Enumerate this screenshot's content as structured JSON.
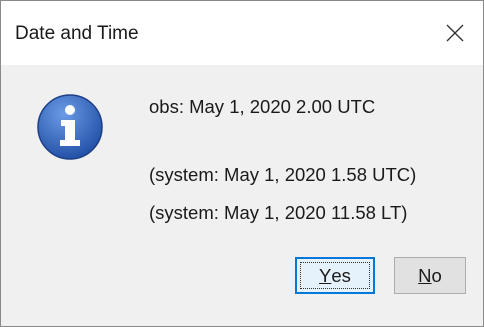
{
  "window": {
    "title": "Date and Time",
    "close_icon": "close-icon"
  },
  "message": {
    "icon": "info-icon",
    "obs": "obs: May 1, 2020 2.00 UTC",
    "system_utc": "(system: May 1, 2020 1.58 UTC)",
    "system_lt": "(system: May 1, 2020 11.58 LT)"
  },
  "buttons": {
    "yes_mnemonic": "Y",
    "yes_rest": "es",
    "no_mnemonic": "N",
    "no_rest": "o"
  },
  "colors": {
    "icon_blue": "#3a6fc4",
    "focus_border": "#0078d7"
  }
}
